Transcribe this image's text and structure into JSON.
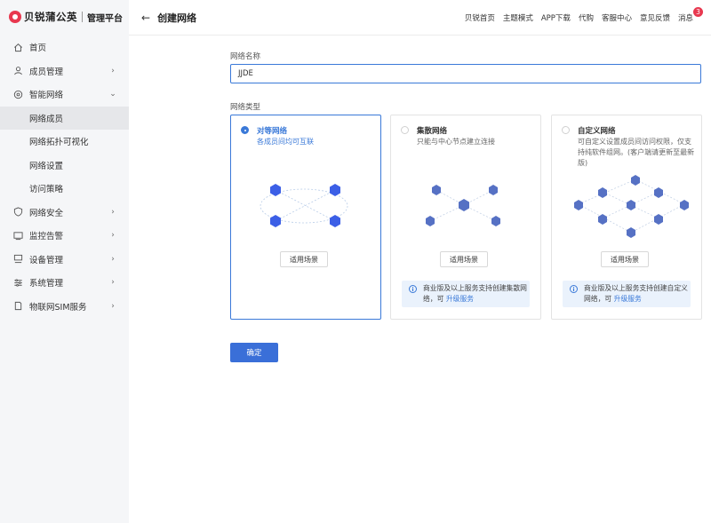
{
  "brand": {
    "name": "贝锐蒲公英",
    "sub": "管理平台",
    "color": "#e8384f"
  },
  "sidebar": {
    "items": [
      {
        "label": "首页",
        "icon": "home-icon",
        "chevron": ""
      },
      {
        "label": "成员管理",
        "icon": "user-icon",
        "chevron": "›"
      },
      {
        "label": "智能网络",
        "icon": "network-icon",
        "chevron": "⌄"
      },
      {
        "label": "网络安全",
        "icon": "shield-icon",
        "chevron": "›"
      },
      {
        "label": "监控告警",
        "icon": "monitor-icon",
        "chevron": "›"
      },
      {
        "label": "设备管理",
        "icon": "device-icon",
        "chevron": "›"
      },
      {
        "label": "系统管理",
        "icon": "settings-icon",
        "chevron": "›"
      },
      {
        "label": "物联网SIM服务",
        "icon": "sim-icon",
        "chevron": "›"
      }
    ],
    "sub_items": [
      "网络成员",
      "网络拓扑可视化",
      "网络设置",
      "访问策略"
    ],
    "active_sub": "网络成员"
  },
  "topbar": {
    "back_icon": "arrow-left-icon",
    "title": "创建网络",
    "links": [
      "贝锐首页",
      "主题模式",
      "APP下载",
      "代购",
      "客服中心",
      "意见反馈"
    ],
    "messages_label": "消息",
    "messages_count": "3"
  },
  "form": {
    "name_label": "网络名称",
    "name_value": "JJDE",
    "type_label": "网络类型",
    "cards": [
      {
        "title": "对等网络",
        "desc": "各成员间均可互联",
        "scene_button": "适用场景",
        "selected": true,
        "notice": "",
        "notice_link": ""
      },
      {
        "title": "集散网络",
        "desc": "只能与中心节点建立连接",
        "scene_button": "适用场景",
        "selected": false,
        "notice": "商业版及以上服务支持创建集散网络，可",
        "notice_link": "升级服务"
      },
      {
        "title": "自定义网络",
        "desc": "可自定义设置成员间访问权限，仅支持纯软件组网。(客户端请更新至最新版)",
        "scene_button": "适用场景",
        "selected": false,
        "notice": "商业版及以上服务支持创建自定义网络，可",
        "notice_link": "升级服务"
      }
    ],
    "confirm_label": "确定",
    "accent_color": "#3a79d8"
  }
}
